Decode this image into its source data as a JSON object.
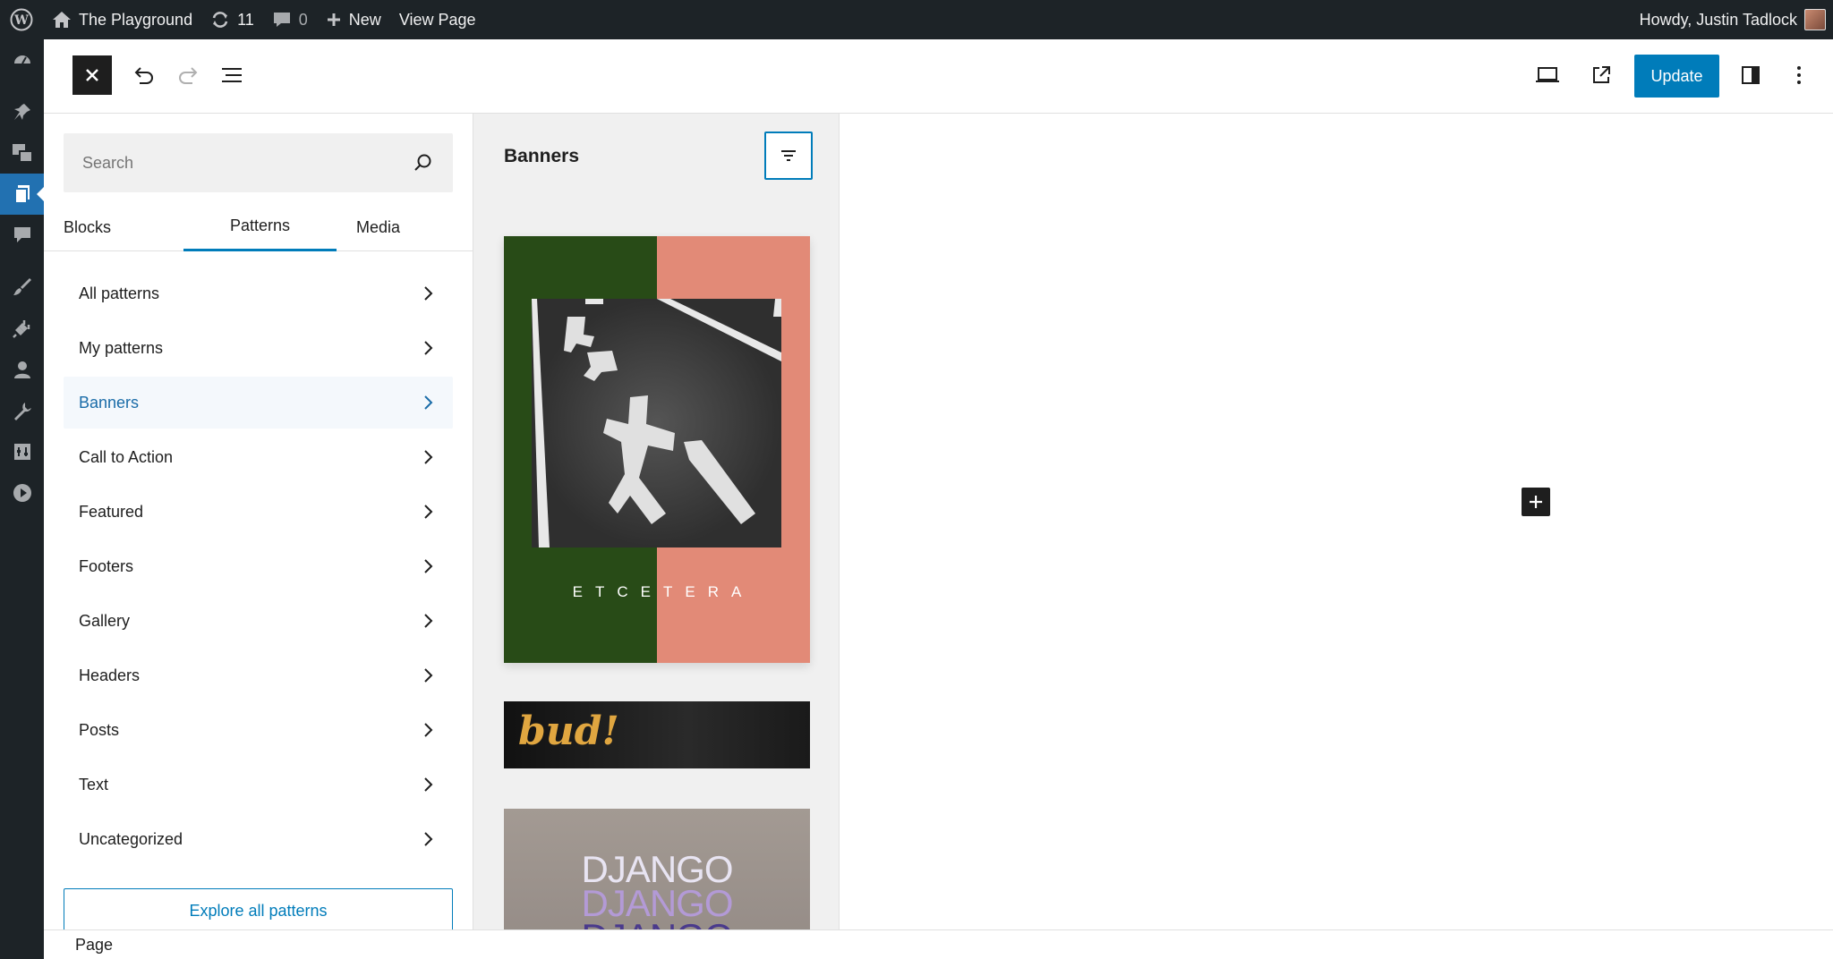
{
  "adminbar": {
    "site_name": "The Playground",
    "updates_count": "11",
    "comments_count": "0",
    "new_label": "New",
    "view_page_label": "View Page",
    "howdy": "Howdy, Justin Tadlock"
  },
  "header": {
    "update_label": "Update"
  },
  "inserter": {
    "search_placeholder": "Search",
    "tabs": [
      "Blocks",
      "Patterns",
      "Media"
    ],
    "active_tab": "Patterns",
    "categories": [
      {
        "label": "All patterns"
      },
      {
        "label": "My patterns"
      },
      {
        "label": "Banners"
      },
      {
        "label": "Call to Action"
      },
      {
        "label": "Featured"
      },
      {
        "label": "Footers"
      },
      {
        "label": "Gallery"
      },
      {
        "label": "Headers"
      },
      {
        "label": "Posts"
      },
      {
        "label": "Text"
      },
      {
        "label": "Uncategorized"
      }
    ],
    "active_category": "Banners",
    "explore_label": "Explore all patterns"
  },
  "patterns_panel": {
    "title": "Banners",
    "cards": [
      {
        "label": "ETCETERA",
        "colors": {
          "left": "#284b17",
          "right": "#e28a77"
        }
      },
      {
        "label": "bud!",
        "color": "#e0a640"
      },
      {
        "lines": [
          "DJANGO",
          "DJANGO",
          "DJANGO"
        ],
        "colors": [
          "#e8e4f2",
          "#b39ad6",
          "#4a3a8c"
        ]
      }
    ]
  },
  "footer": {
    "breadcrumb": "Page"
  },
  "colors": {
    "accent": "#007cba",
    "admin_bg": "#1d2327",
    "admin_active": "#2271b1"
  }
}
